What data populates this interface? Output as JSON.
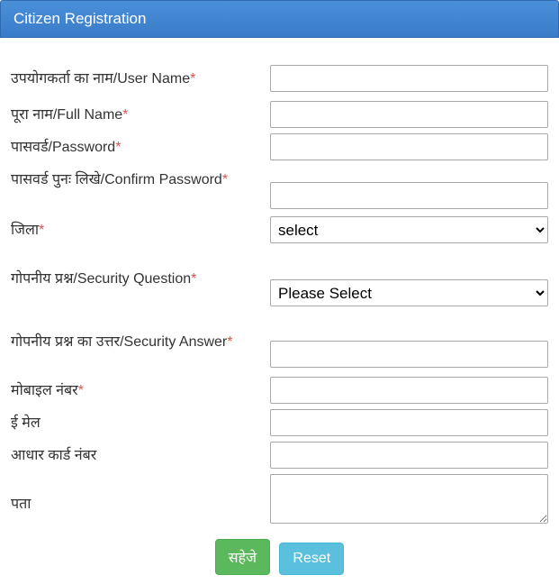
{
  "header": {
    "title": "Citizen Registration"
  },
  "form": {
    "userName": {
      "label": "उपयोगकर्ता का नाम/User Name",
      "value": ""
    },
    "fullName": {
      "label": "पूरा नाम/Full Name",
      "value": ""
    },
    "password": {
      "label": "पासवर्ड/Password",
      "value": ""
    },
    "confirmPassword": {
      "label": "पासवर्ड पुनः लिखे/Confirm Password",
      "value": ""
    },
    "district": {
      "label": "जिला",
      "selected": "select",
      "options": [
        "select"
      ]
    },
    "securityQuestion": {
      "label": "गोपनीय प्रश्न/Security Question",
      "selected": "Please Select",
      "options": [
        "Please Select"
      ]
    },
    "securityAnswer": {
      "label": "गोपनीय प्रश्न का उत्तर/Security Answer",
      "value": ""
    },
    "mobile": {
      "label": "मोबाइल नंबर",
      "value": ""
    },
    "email": {
      "label": "ई मेल",
      "value": ""
    },
    "aadhaar": {
      "label": "आधार कार्ड नंबर",
      "value": ""
    },
    "address": {
      "label": "पता",
      "value": ""
    }
  },
  "buttons": {
    "save": "सहेजे",
    "reset": "Reset"
  },
  "requiredMark": "*"
}
